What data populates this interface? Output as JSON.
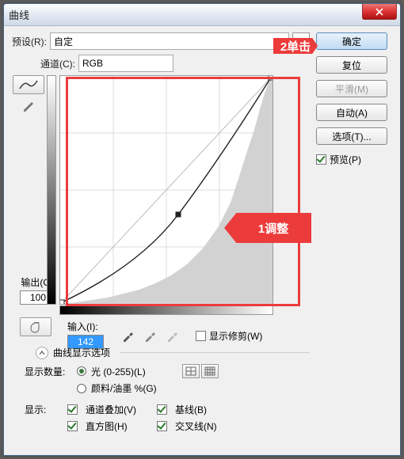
{
  "title": "曲线",
  "preset": {
    "label": "预设(R):",
    "value": "自定"
  },
  "channel": {
    "label": "通道(C):",
    "value": "RGB"
  },
  "output": {
    "label": "输出(O):",
    "value": "100"
  },
  "input": {
    "label": "输入(I):",
    "value": "142"
  },
  "clip": {
    "label": "显示修剪(W)"
  },
  "section_header": "曲线显示选项",
  "display_amount": {
    "label": "显示数量:",
    "opt_light": "光 (0-255)(L)",
    "opt_pigment": "颜料/油墨 %(G)"
  },
  "show": {
    "label": "显示:",
    "opt1": "通道叠加(V)",
    "opt2": "基线(B)",
    "opt3": "直方图(H)",
    "opt4": "交叉线(N)"
  },
  "buttons": {
    "ok": "确定",
    "reset": "复位",
    "smooth": "平滑(M)",
    "auto": "自动(A)",
    "options": "选项(T)...",
    "preview": "预览(P)"
  },
  "callouts": {
    "c1": "1调整",
    "c2": "2单击"
  },
  "chart_data": {
    "type": "line",
    "title": "Curves",
    "xlabel": "Input",
    "ylabel": "Output",
    "xlim": [
      0,
      255
    ],
    "ylim": [
      0,
      255
    ],
    "series": [
      {
        "name": "curve",
        "x": [
          0,
          142,
          255
        ],
        "y": [
          0,
          100,
          255
        ]
      }
    ],
    "control_point": {
      "input": 142,
      "output": 100
    }
  }
}
